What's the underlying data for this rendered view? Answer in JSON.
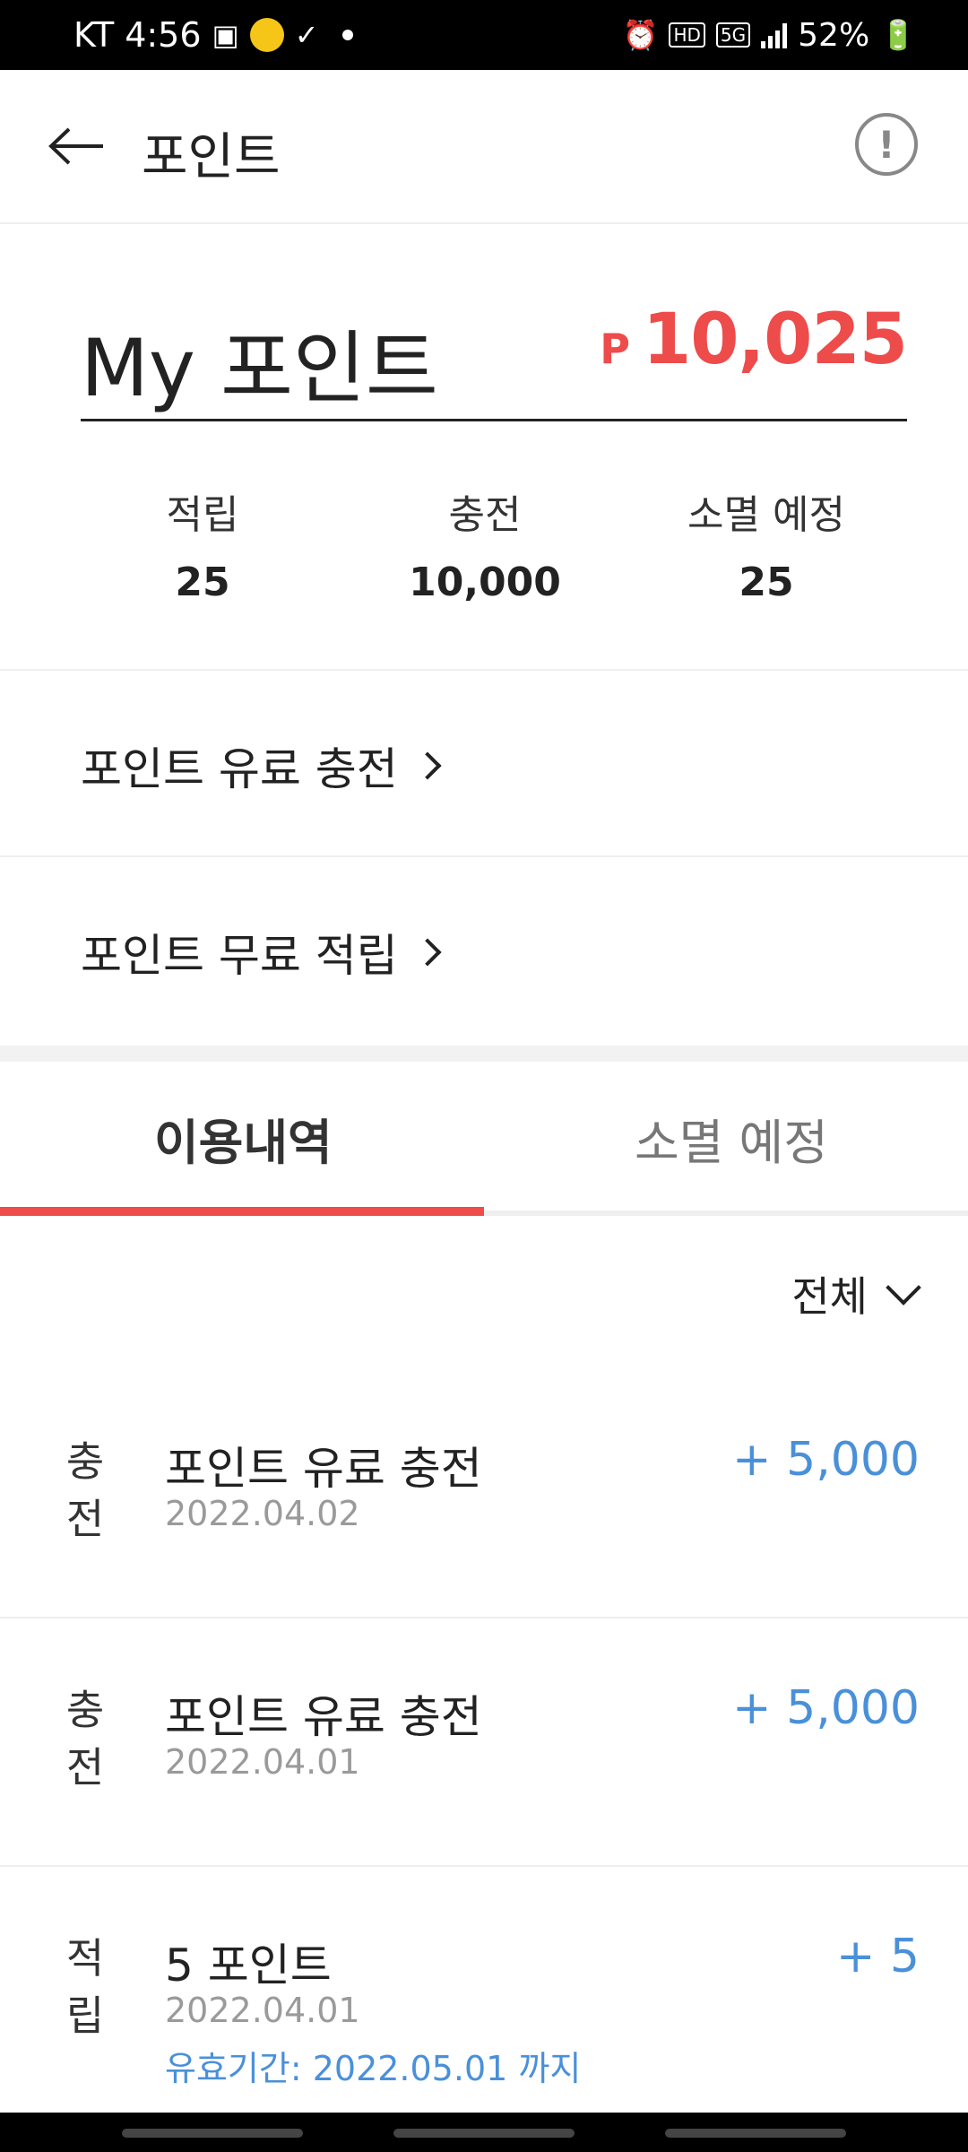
{
  "status_bar": {
    "carrier": "KT",
    "time": "4:56",
    "hd": "HD",
    "network": "5G",
    "battery": "52%"
  },
  "header": {
    "title": "포인트",
    "info_icon": "!"
  },
  "summary": {
    "title": "My 포인트",
    "currency_symbol": "P",
    "total": "10,025",
    "stats": [
      {
        "label": "적립",
        "value": "25"
      },
      {
        "label": "충전",
        "value": "10,000"
      },
      {
        "label": "소멸 예정",
        "value": "25"
      }
    ]
  },
  "links": {
    "paid_charge": "포인트 유료 충전",
    "free_earn": "포인트 무료 적립"
  },
  "tabs": {
    "history": "이용내역",
    "expiring": "소멸 예정"
  },
  "filter": {
    "selected": "전체"
  },
  "history": [
    {
      "type_line1": "충",
      "type_line2": "전",
      "title": "포인트 유료 충전",
      "date": "2022.04.02",
      "amount": "+ 5,000",
      "expire": ""
    },
    {
      "type_line1": "충",
      "type_line2": "전",
      "title": "포인트 유료 충전",
      "date": "2022.04.01",
      "amount": "+ 5,000",
      "expire": ""
    },
    {
      "type_line1": "적",
      "type_line2": "립",
      "title": "5 포인트",
      "date": "2022.04.01",
      "amount": "+ 5",
      "expire": "유효기간: 2022.05.01 까지"
    }
  ],
  "colors": {
    "accent": "#ee4b4b",
    "positive": "#4a90d9"
  }
}
